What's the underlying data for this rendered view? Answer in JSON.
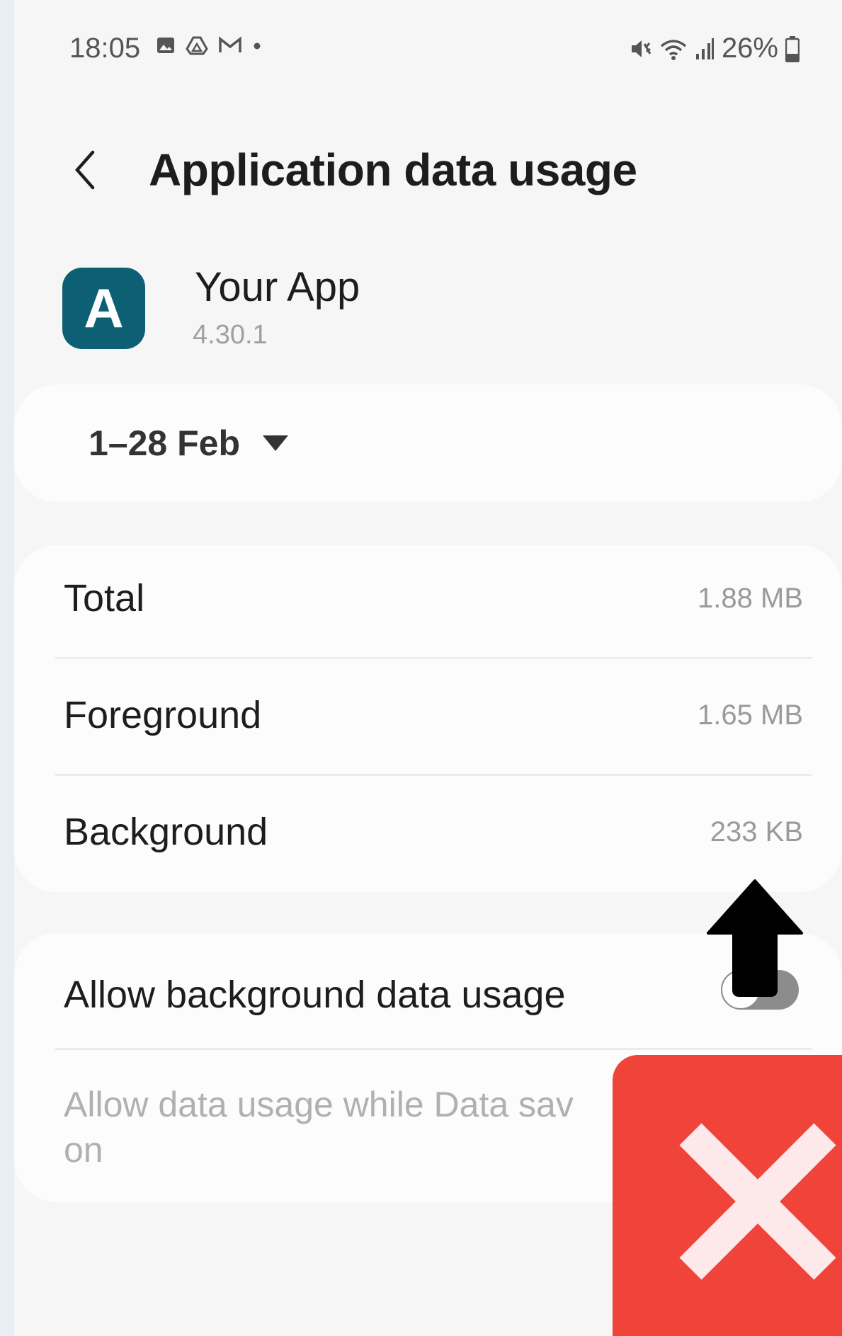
{
  "status_bar": {
    "time": "18:05",
    "battery": "26%",
    "icons": [
      "gallery-icon",
      "drive-icon",
      "gmail-icon",
      "dot-icon",
      "mute-icon",
      "wifi-icon",
      "signal-icon",
      "battery-icon"
    ]
  },
  "header": {
    "title": "Application data usage"
  },
  "app": {
    "icon_letter": "A",
    "name": "Your App",
    "version": "4.30.1",
    "icon_color": "#0d5f73"
  },
  "date_range": {
    "label": "1–28 Feb"
  },
  "usage": {
    "rows": [
      {
        "label": "Total",
        "value": "1.88 MB"
      },
      {
        "label": "Foreground",
        "value": "1.65 MB"
      },
      {
        "label": "Background",
        "value": "233 KB"
      }
    ]
  },
  "background_data": {
    "title": "Allow background data usage",
    "description": "Allow data usage while Data sav",
    "description_line2": "on",
    "enabled": false
  },
  "overlay": {
    "arrow_color": "#000000",
    "cross_bg": "#f0433a",
    "cross_color": "#fde8ea"
  }
}
